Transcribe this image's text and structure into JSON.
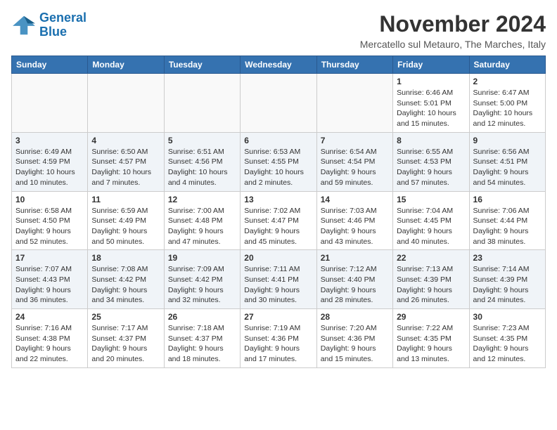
{
  "header": {
    "logo_line1": "General",
    "logo_line2": "Blue",
    "month_title": "November 2024",
    "location": "Mercatello sul Metauro, The Marches, Italy"
  },
  "weekdays": [
    "Sunday",
    "Monday",
    "Tuesday",
    "Wednesday",
    "Thursday",
    "Friday",
    "Saturday"
  ],
  "weeks": [
    [
      {
        "day": "",
        "info": ""
      },
      {
        "day": "",
        "info": ""
      },
      {
        "day": "",
        "info": ""
      },
      {
        "day": "",
        "info": ""
      },
      {
        "day": "",
        "info": ""
      },
      {
        "day": "1",
        "info": "Sunrise: 6:46 AM\nSunset: 5:01 PM\nDaylight: 10 hours and 15 minutes."
      },
      {
        "day": "2",
        "info": "Sunrise: 6:47 AM\nSunset: 5:00 PM\nDaylight: 10 hours and 12 minutes."
      }
    ],
    [
      {
        "day": "3",
        "info": "Sunrise: 6:49 AM\nSunset: 4:59 PM\nDaylight: 10 hours and 10 minutes."
      },
      {
        "day": "4",
        "info": "Sunrise: 6:50 AM\nSunset: 4:57 PM\nDaylight: 10 hours and 7 minutes."
      },
      {
        "day": "5",
        "info": "Sunrise: 6:51 AM\nSunset: 4:56 PM\nDaylight: 10 hours and 4 minutes."
      },
      {
        "day": "6",
        "info": "Sunrise: 6:53 AM\nSunset: 4:55 PM\nDaylight: 10 hours and 2 minutes."
      },
      {
        "day": "7",
        "info": "Sunrise: 6:54 AM\nSunset: 4:54 PM\nDaylight: 9 hours and 59 minutes."
      },
      {
        "day": "8",
        "info": "Sunrise: 6:55 AM\nSunset: 4:53 PM\nDaylight: 9 hours and 57 minutes."
      },
      {
        "day": "9",
        "info": "Sunrise: 6:56 AM\nSunset: 4:51 PM\nDaylight: 9 hours and 54 minutes."
      }
    ],
    [
      {
        "day": "10",
        "info": "Sunrise: 6:58 AM\nSunset: 4:50 PM\nDaylight: 9 hours and 52 minutes."
      },
      {
        "day": "11",
        "info": "Sunrise: 6:59 AM\nSunset: 4:49 PM\nDaylight: 9 hours and 50 minutes."
      },
      {
        "day": "12",
        "info": "Sunrise: 7:00 AM\nSunset: 4:48 PM\nDaylight: 9 hours and 47 minutes."
      },
      {
        "day": "13",
        "info": "Sunrise: 7:02 AM\nSunset: 4:47 PM\nDaylight: 9 hours and 45 minutes."
      },
      {
        "day": "14",
        "info": "Sunrise: 7:03 AM\nSunset: 4:46 PM\nDaylight: 9 hours and 43 minutes."
      },
      {
        "day": "15",
        "info": "Sunrise: 7:04 AM\nSunset: 4:45 PM\nDaylight: 9 hours and 40 minutes."
      },
      {
        "day": "16",
        "info": "Sunrise: 7:06 AM\nSunset: 4:44 PM\nDaylight: 9 hours and 38 minutes."
      }
    ],
    [
      {
        "day": "17",
        "info": "Sunrise: 7:07 AM\nSunset: 4:43 PM\nDaylight: 9 hours and 36 minutes."
      },
      {
        "day": "18",
        "info": "Sunrise: 7:08 AM\nSunset: 4:42 PM\nDaylight: 9 hours and 34 minutes."
      },
      {
        "day": "19",
        "info": "Sunrise: 7:09 AM\nSunset: 4:42 PM\nDaylight: 9 hours and 32 minutes."
      },
      {
        "day": "20",
        "info": "Sunrise: 7:11 AM\nSunset: 4:41 PM\nDaylight: 9 hours and 30 minutes."
      },
      {
        "day": "21",
        "info": "Sunrise: 7:12 AM\nSunset: 4:40 PM\nDaylight: 9 hours and 28 minutes."
      },
      {
        "day": "22",
        "info": "Sunrise: 7:13 AM\nSunset: 4:39 PM\nDaylight: 9 hours and 26 minutes."
      },
      {
        "day": "23",
        "info": "Sunrise: 7:14 AM\nSunset: 4:39 PM\nDaylight: 9 hours and 24 minutes."
      }
    ],
    [
      {
        "day": "24",
        "info": "Sunrise: 7:16 AM\nSunset: 4:38 PM\nDaylight: 9 hours and 22 minutes."
      },
      {
        "day": "25",
        "info": "Sunrise: 7:17 AM\nSunset: 4:37 PM\nDaylight: 9 hours and 20 minutes."
      },
      {
        "day": "26",
        "info": "Sunrise: 7:18 AM\nSunset: 4:37 PM\nDaylight: 9 hours and 18 minutes."
      },
      {
        "day": "27",
        "info": "Sunrise: 7:19 AM\nSunset: 4:36 PM\nDaylight: 9 hours and 17 minutes."
      },
      {
        "day": "28",
        "info": "Sunrise: 7:20 AM\nSunset: 4:36 PM\nDaylight: 9 hours and 15 minutes."
      },
      {
        "day": "29",
        "info": "Sunrise: 7:22 AM\nSunset: 4:35 PM\nDaylight: 9 hours and 13 minutes."
      },
      {
        "day": "30",
        "info": "Sunrise: 7:23 AM\nSunset: 4:35 PM\nDaylight: 9 hours and 12 minutes."
      }
    ]
  ]
}
